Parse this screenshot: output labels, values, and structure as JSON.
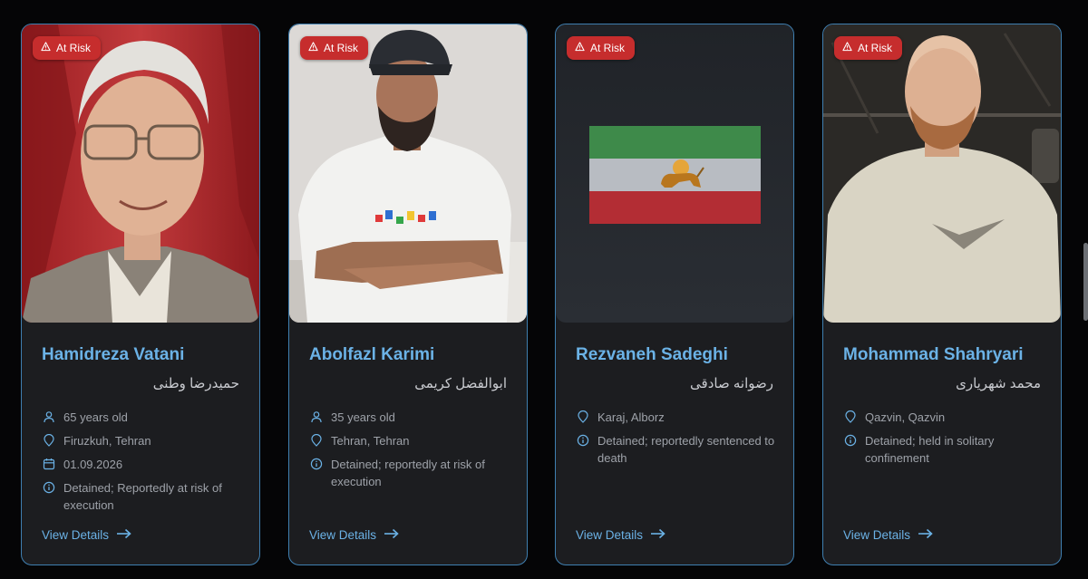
{
  "badge_label": "At Risk",
  "view_details_label": "View Details",
  "colors": {
    "accent": "#6bb2e6",
    "border": "#3f7fb0",
    "badge": "#c62d2d",
    "card": "#1c1d20"
  },
  "cards": [
    {
      "name": "Hamidreza Vatani",
      "native_name": "حمیدرضا وطنی",
      "details": {
        "age": "65 years old",
        "location": "Firuzkuh, Tehran",
        "date": "01.09.2026",
        "status": "Detained; Reportedly at risk of execution"
      }
    },
    {
      "name": "Abolfazl Karimi",
      "native_name": "ابوالفضل کریمی",
      "details": {
        "age": "35 years old",
        "location": "Tehran, Tehran",
        "status": "Detained; reportedly at risk of execution"
      }
    },
    {
      "name": "Rezvaneh Sadeghi",
      "native_name": "رضوانه صادقی",
      "details": {
        "location": "Karaj, Alborz",
        "status": "Detained; reportedly sentenced to death"
      }
    },
    {
      "name": "Mohammad Shahryari",
      "native_name": "محمد شهریاری",
      "details": {
        "location": "Qazvin, Qazvin",
        "status": "Detained; held in solitary confinement"
      }
    }
  ],
  "icons": {
    "age": "person-icon",
    "location": "map-pin-icon",
    "date": "calendar-icon",
    "status": "info-icon",
    "badge": "warning-triangle-icon",
    "view": "arrow-right-icon"
  }
}
